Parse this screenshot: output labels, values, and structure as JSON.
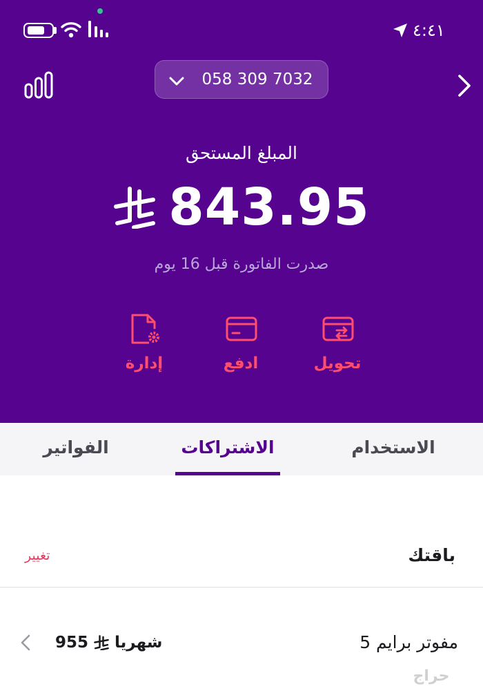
{
  "status_bar": {
    "time": "٤:٤١",
    "icons": [
      "battery-icon",
      "wifi-icon",
      "signal-icon",
      "location-icon"
    ]
  },
  "header": {
    "phone_number": "058 309 7032",
    "icons": [
      "stats-icon",
      "chevron-down-icon",
      "chevron-right-icon"
    ]
  },
  "bill": {
    "label": "المبلغ المستحق",
    "amount": "843.95",
    "currency_icon": "riyal-icon",
    "issued_text": "صدرت الفاتورة قبل 16 يوم"
  },
  "actions": [
    {
      "id": "transfer",
      "label": "تحويل",
      "icon": "card-transfer-icon"
    },
    {
      "id": "pay",
      "label": "ادفع",
      "icon": "card-icon"
    },
    {
      "id": "manage",
      "label": "إدارة",
      "icon": "document-gear-icon"
    }
  ],
  "tabs": {
    "usage": "الاستخدام",
    "subscriptions": "الاشتراكات",
    "bills": "الفواتير",
    "active": "subscriptions"
  },
  "plan": {
    "section_title": "باقتك",
    "change_label": "تغيير",
    "name": "مفوتر برايم 5",
    "price": "955",
    "period": "شهريا"
  },
  "watermark": "حراج",
  "colors": {
    "header_bg": "#56048f",
    "accent": "#ff4d6d",
    "tab_active": "#56048f",
    "link": "#e8385e"
  }
}
